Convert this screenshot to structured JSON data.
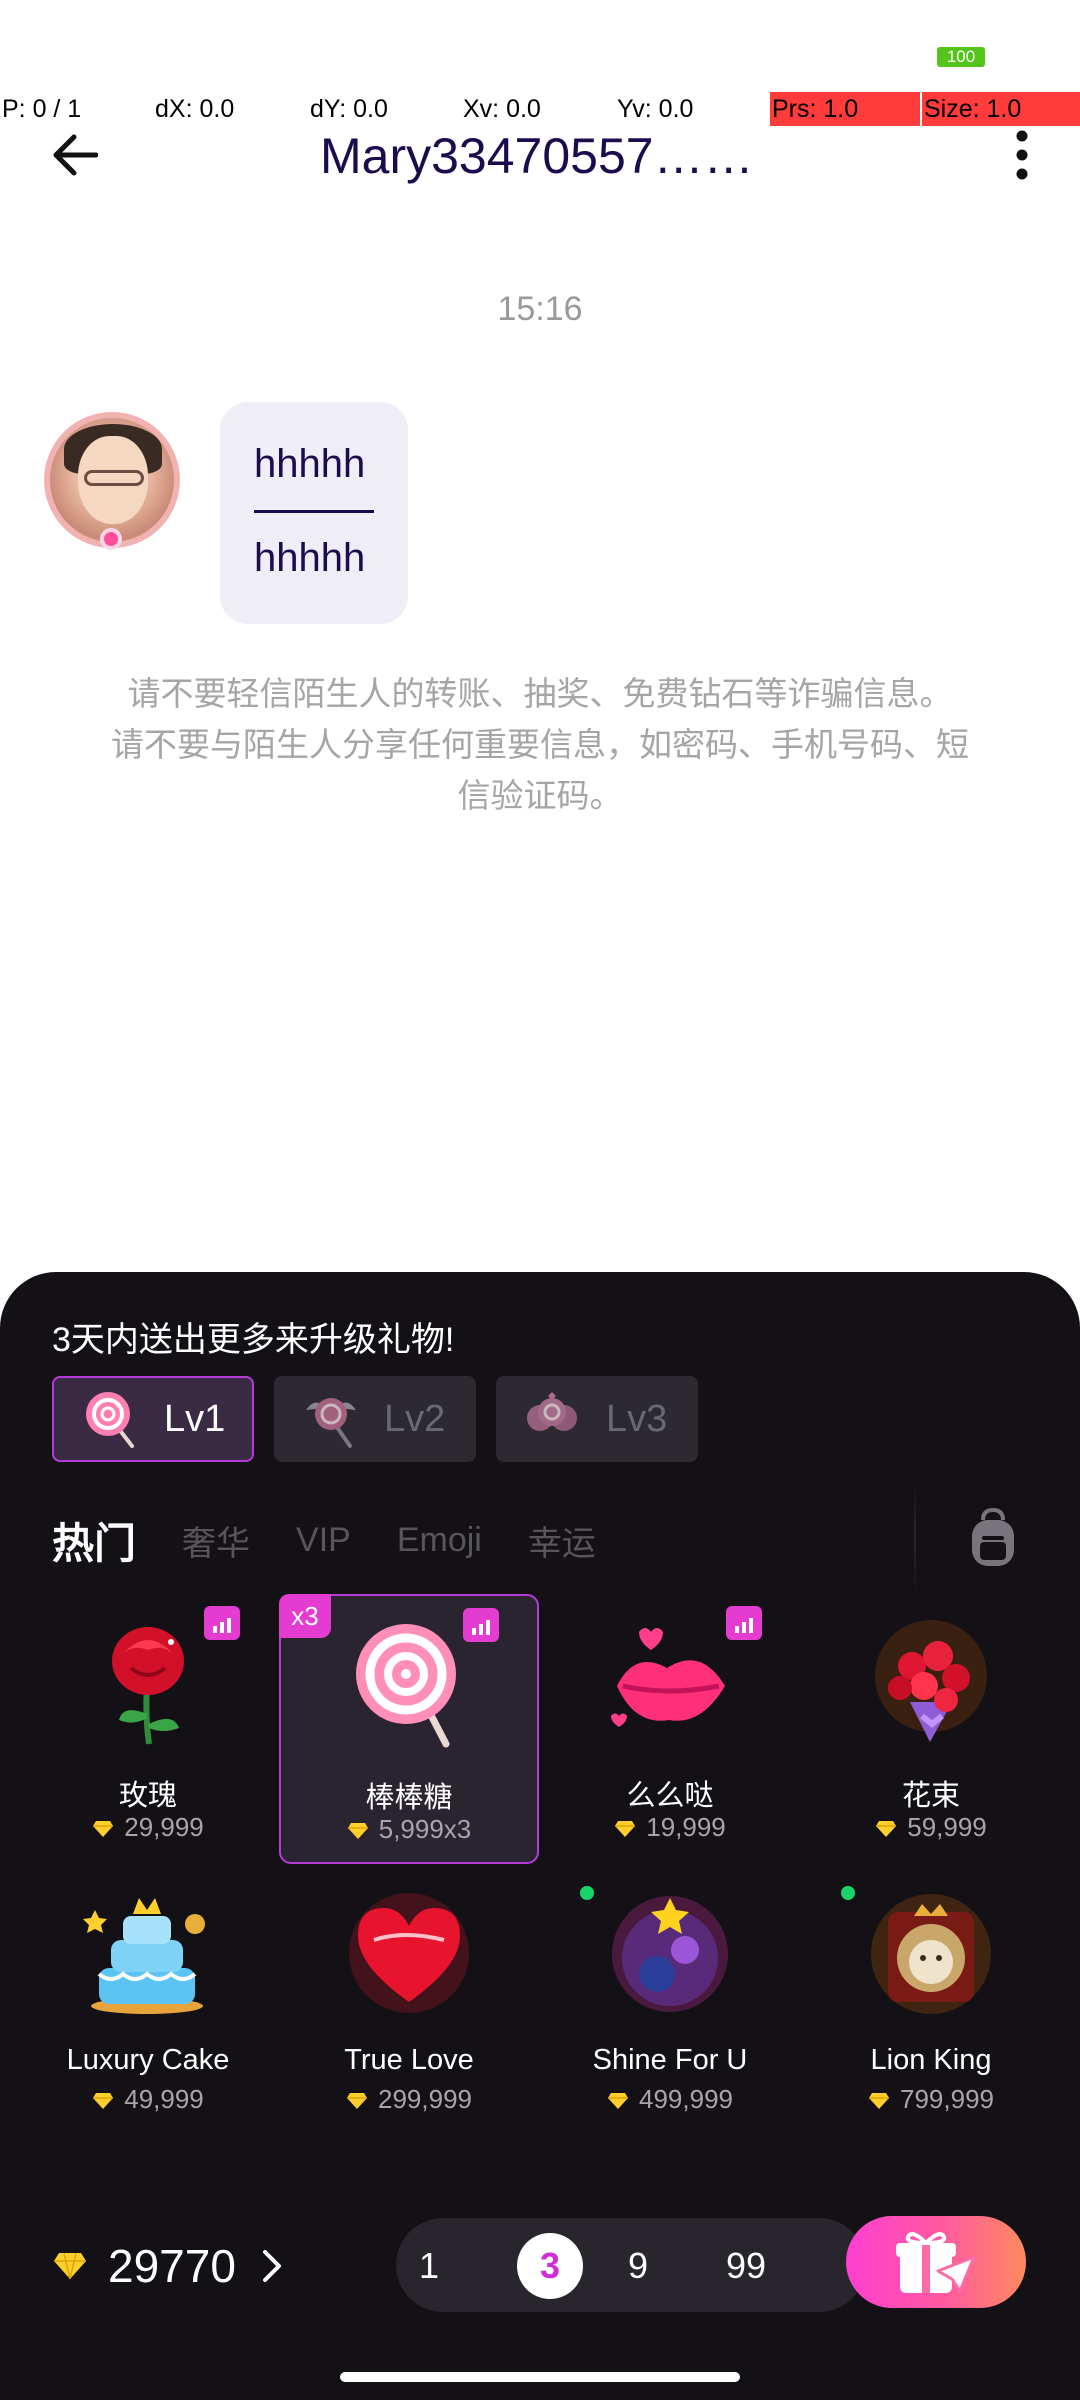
{
  "status": {
    "battery": "100"
  },
  "debug": {
    "pointer": "P: 0 / 1",
    "dx": "dX: 0.0",
    "dy": "dY: 0.0",
    "xv": "Xv: 0.0",
    "yv": "Yv: 0.0",
    "prs": "Prs: 1.0",
    "size": "Size: 1.0"
  },
  "header": {
    "title": "Mary33470557……"
  },
  "chat": {
    "timestamp": "15:16",
    "message_line1": "hhhhh",
    "message_line2": "hhhhh",
    "warning": "请不要轻信陌生人的转账、抽奖、免费钻石等诈骗信息。 请不要与陌生人分享任何重要信息，如密码、手机号码、短信验证码。"
  },
  "gift_panel": {
    "upgrade_tip": "3天内送出更多来升级礼物!",
    "levels": [
      "Lv1",
      "Lv2",
      "Lv3"
    ],
    "tabs": [
      "热门",
      "奢华",
      "VIP",
      "Emoji",
      "幸运"
    ],
    "gifts": [
      {
        "name": "玫瑰",
        "price": "29,999"
      },
      {
        "name": "棒棒糖",
        "price": "5,999x3",
        "combo": "x3"
      },
      {
        "name": "么么哒",
        "price": "19,999"
      },
      {
        "name": "花束",
        "price": "59,999"
      },
      {
        "name": "Luxury Cake",
        "price": "49,999"
      },
      {
        "name": "True Love",
        "price": "299,999"
      },
      {
        "name": "Shine For U",
        "price": "499,999"
      },
      {
        "name": "Lion King",
        "price": "799,999"
      }
    ],
    "balance": "29770",
    "quantities": [
      "1",
      "3",
      "9",
      "99"
    ],
    "selected_quantity": "3"
  },
  "colors": {
    "accent": "#e43bd0",
    "title": "#1c0c4d",
    "panel_bg": "#141116"
  }
}
